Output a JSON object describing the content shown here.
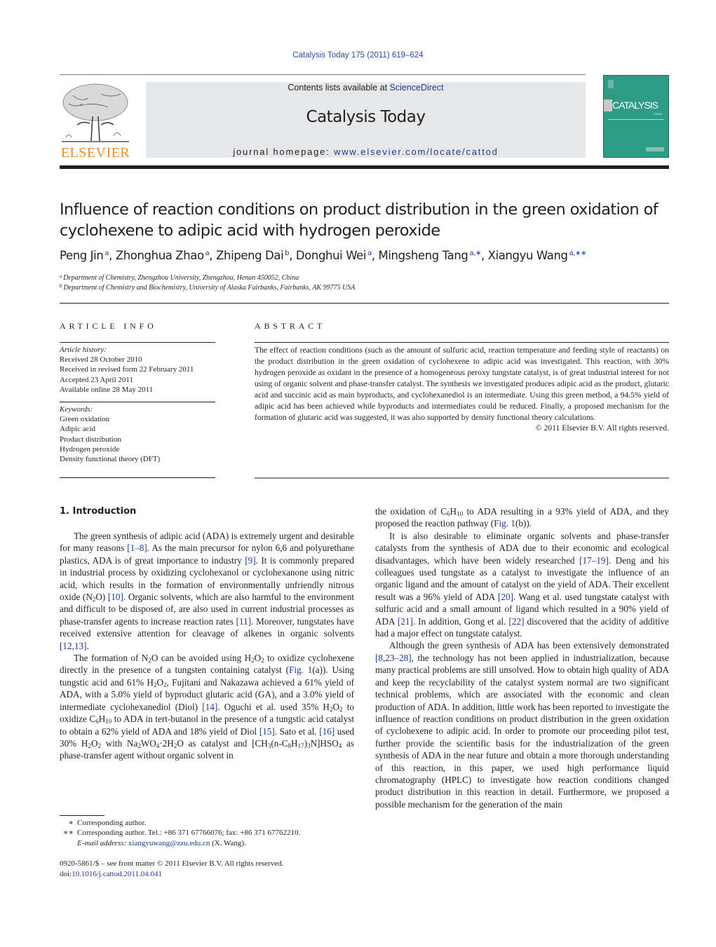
{
  "header": {
    "citation": "Catalysis Today 175 (2011) 619–624",
    "contents_prefix": "Contents lists available at ",
    "contents_link": "ScienceDirect",
    "journal_name": "Catalysis Today",
    "homepage_prefix": "journal homepage: ",
    "homepage_url": "www.elsevier.com/locate/cattod",
    "publisher_logo_text": "ELSEVIER",
    "cover_title": "CATALYSIS",
    "cover_subtitle": "TODAY"
  },
  "article": {
    "title": "Influence of reaction conditions on product distribution in the green oxidation of cyclohexene to adipic acid with hydrogen peroxide",
    "authors": [
      {
        "name": "Peng Jin",
        "mark": "a"
      },
      {
        "name": "Zhonghua Zhao",
        "mark": "a"
      },
      {
        "name": "Zhipeng Dai",
        "mark": "b"
      },
      {
        "name": "Donghui Wei",
        "mark": "a"
      },
      {
        "name": "Mingsheng Tang",
        "mark": "a,∗"
      },
      {
        "name": "Xiangyu Wang",
        "mark": "a,∗∗"
      }
    ],
    "affiliations": [
      {
        "mark": "a",
        "text": "Department of Chemistry, Zhengzhou University, Zhengzhou, Henan 450052, China"
      },
      {
        "mark": "b",
        "text": "Department of Chemistry and Biochemistry, University of Alaska Fairbanks, Fairbanks, AK 99775 USA"
      }
    ]
  },
  "article_info": {
    "heading": "ARTICLE INFO",
    "history_label": "Article history:",
    "history": [
      "Received 28 October 2010",
      "Received in revised form 22 February 2011",
      "Accepted 23 April 2011",
      "Available online 28 May 2011"
    ],
    "keywords_label": "Keywords:",
    "keywords": [
      "Green oxidation",
      "Adipic acid",
      "Product distribution",
      "Hydrogen peroxide",
      "Density functional theory (DFT)"
    ]
  },
  "abstract": {
    "heading": "ABSTRACT",
    "text": "The effect of reaction conditions (such as the amount of sulfuric acid, reaction temperature and feeding style of reactants) on the product distribution in the green oxidation of cyclohexene to adipic acid was investigated. This reaction, with 30% hydrogen peroxide as oxidant in the presence of a homogeneous peroxy tungstate catalyst, is of great industrial interest for not using of organic solvent and phase-transfer catalyst. The synthesis we investigated produces adipic acid as the product, glutaric acid and succinic acid as main byproducts, and cyclohexanediol is an intermediate. Using this green method, a 94.5% yield of adipic acid has been achieved while byproducts and intermediates could be reduced. Finally, a proposed mechanism for the formation of glutaric acid was suggested, it was also supported by density functional theory calculations.",
    "copyright": "© 2011 Elsevier B.V. All rights reserved."
  },
  "body": {
    "section_heading": "1.  Introduction",
    "p1": {
      "a": "The green synthesis of adipic acid (ADA) is extremely urgent and desirable for many reasons ",
      "r1": "[1–8]",
      "b": ". As the main precursor for nylon 6,6 and polyurethane plastics, ADA is of great importance to industry ",
      "r2": "[9]",
      "c": ". It is commonly prepared in industrial process by oxidizing cyclohexanol or cyclohexanone using nitric acid, which results in the formation of environmentally unfriendly nitrous oxide (N",
      "c_sub": "2",
      "c2": "O) ",
      "r3": "[10]",
      "d": ". Organic solvents, which are also harmful to the environment and difficult to be disposed of, are also used in current industrial processes as phase-transfer agents to increase reaction rates ",
      "r4": "[11]",
      "e": ". Moreover, tungstates have received extensive attention for cleavage of alkenes in organic solvents ",
      "r5": "[12,13]",
      "f": "."
    },
    "p2": {
      "a": "The formation of N",
      "a_sub": "2",
      "a2": "O can be avoided using H",
      "a3": "O",
      "a4": " to oxidize cyclohexene directly in the presence of a tungsten containing catalyst (",
      "fig": "Fig. 1",
      "b": "(a)). Using tungstic acid and 61% H",
      "b2": "O",
      "b3": ", Fujitani and Nakazawa achieved a 61% yield of ADA, with a 5.0% yield of byproduct glutaric acid (GA), and a 3.0% yield of intermediate cyclohexanediol (Diol) ",
      "r1": "[14]",
      "c": ". Oguchi et al. used 35% H",
      "c2": "O",
      "c3": " to oxidize C",
      "c_sub6": "6",
      "c4": "H",
      "c_sub10": "10",
      "c5": " to ADA in tert-butanol in the presence of a tungstic acid catalyst to obtain a 62% yield of ADA and 18% yield of Diol ",
      "r2": "[15]",
      "d": ". Sato et al. ",
      "r3": "[16]",
      "e": " used 30% H",
      "e2": "O",
      "e3": " with Na",
      "e4": "WO",
      "e_sub4": "4",
      "e5": "·2H",
      "e6": "O as catalyst and [CH",
      "e_sub3": "3",
      "e7": "(n-C",
      "e_sub8": "8",
      "e8": "H",
      "e_sub17": "17",
      "e9": ")",
      "e10": "N]HSO",
      "e11": " as phase-transfer agent without organic solvent in"
    },
    "right_p0": {
      "a": "the oxidation of C",
      "a2": "H",
      "a3": " to ADA resulting in a 93% yield of ADA, and they proposed the reaction pathway (",
      "fig": "Fig. 1",
      "b": "(b))."
    },
    "right_p1": {
      "a": "It is also desirable to eliminate organic solvents and phase-transfer catalysts from the synthesis of ADA due to their economic and ecological disadvantages, which have been widely researched ",
      "r1": "[17–19]",
      "b": ". Deng and his colleagues used tungstate as a catalyst to investigate the influence of an organic ligand and the amount of catalyst on the yield of ADA. Their excellent result was a 96% yield of ADA ",
      "r2": "[20]",
      "c": ". Wang et al. used tungstate catalyst with sulfuric acid and a small amount of ligand which resulted in a 90% yield of ADA ",
      "r3": "[21]",
      "d": ". In addition, Gong et al. ",
      "r4": "[22]",
      "e": " discovered that the acidity of additive had a major effect on tungstate catalyst."
    },
    "right_p2": {
      "a": "Although the green synthesis of ADA has been extensively demonstrated ",
      "r1": "[8,23–28]",
      "b": ", the technology has not been applied in industrialization, because many practical problems are still unsolved. How to obtain high quality of ADA and keep the recyclability of the catalyst system normal are two significant technical problems, which are associated with the economic and clean production of ADA. In addition, little work has been reported to investigate the influence of reaction conditions on product distribution in the green oxidation of cyclohexene to adipic acid. In order to promote our proceeding pilot test, further provide the scientific basis for the industrialization of the green synthesis of ADA in the near future and obtain a more thorough understanding of this reaction, in this paper, we used high performance liquid chromatography (HPLC) to investigate how reaction conditions changed product distribution in this reaction in detail. Furthermore, we proposed a possible mechanism for the generation of the main"
    }
  },
  "footnotes": [
    {
      "mark": "∗",
      "text": "Corresponding author."
    },
    {
      "mark": "∗∗",
      "text": "Corresponding author. Tel.: +86 371 67766076; fax: +86 371 67762210."
    }
  ],
  "email": {
    "label": "E-mail address: ",
    "address": "xiangyuwang@zzu.edu.cn",
    "suffix": " (X. Wang)."
  },
  "front_matter": {
    "issn_line": "0920-5861/$ – see front matter © 2011 Elsevier B.V. All rights reserved.",
    "doi_prefix": "doi:",
    "doi": "10.1016/j.cattod.2011.04.041"
  },
  "colors": {
    "link": "#1f3a93",
    "elsevier_orange": "#f28c28",
    "banner_gray": "#e6e7e8",
    "cover_green": "#2e9b84"
  }
}
